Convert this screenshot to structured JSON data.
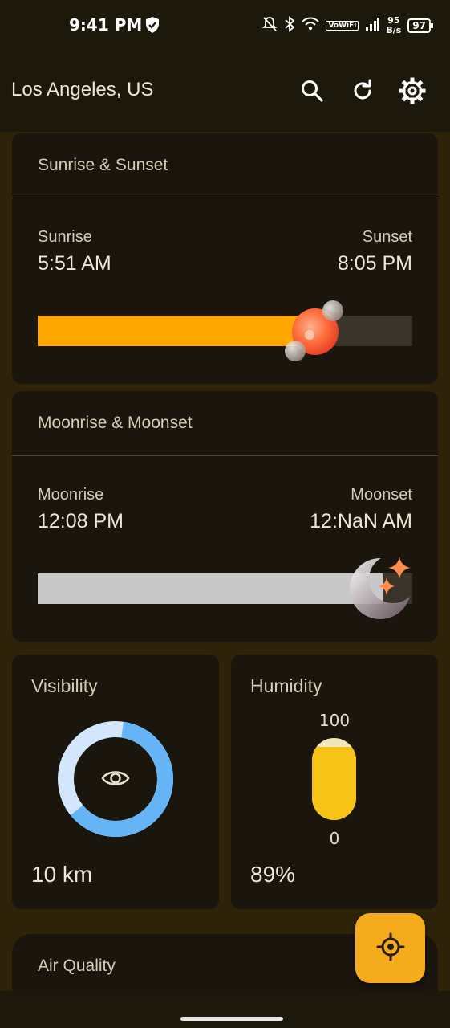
{
  "status_bar": {
    "time": "9:41 PM",
    "network_speed_top": "95",
    "network_speed_bottom": "B/s",
    "volte": "VoWiFi",
    "battery": "97"
  },
  "app_bar": {
    "city": "Los Angeles, US",
    "icons": [
      "search-icon",
      "refresh-icon",
      "settings-icon"
    ]
  },
  "sun": {
    "title": "Sunrise & Sunset",
    "rise_label": "Sunrise",
    "rise_time": "5:51 AM",
    "set_label": "Sunset",
    "set_time": "8:05 PM",
    "progress": 0.74,
    "color": "#ffa600"
  },
  "moon": {
    "title": "Moonrise & Moonset",
    "rise_label": "Moonrise",
    "rise_time": "12:08 PM",
    "set_label": "Moonset",
    "set_time": "12:NaN AM",
    "progress": 0.92,
    "color": "#c8c8c8"
  },
  "visibility": {
    "title": "Visibility",
    "value": "10 km",
    "ring_fraction": 0.62,
    "ring_color": "#64b4f6",
    "ring_track_color": "#d4e6fb"
  },
  "humidity": {
    "title": "Humidity",
    "max_label": "100",
    "min_label": "0",
    "value": "89%",
    "level": 0.89,
    "color": "#f7c317"
  },
  "air_quality": {
    "title": "Air Quality"
  },
  "fab": {
    "icon": "my-location-icon",
    "color": "#f4ab1c"
  }
}
